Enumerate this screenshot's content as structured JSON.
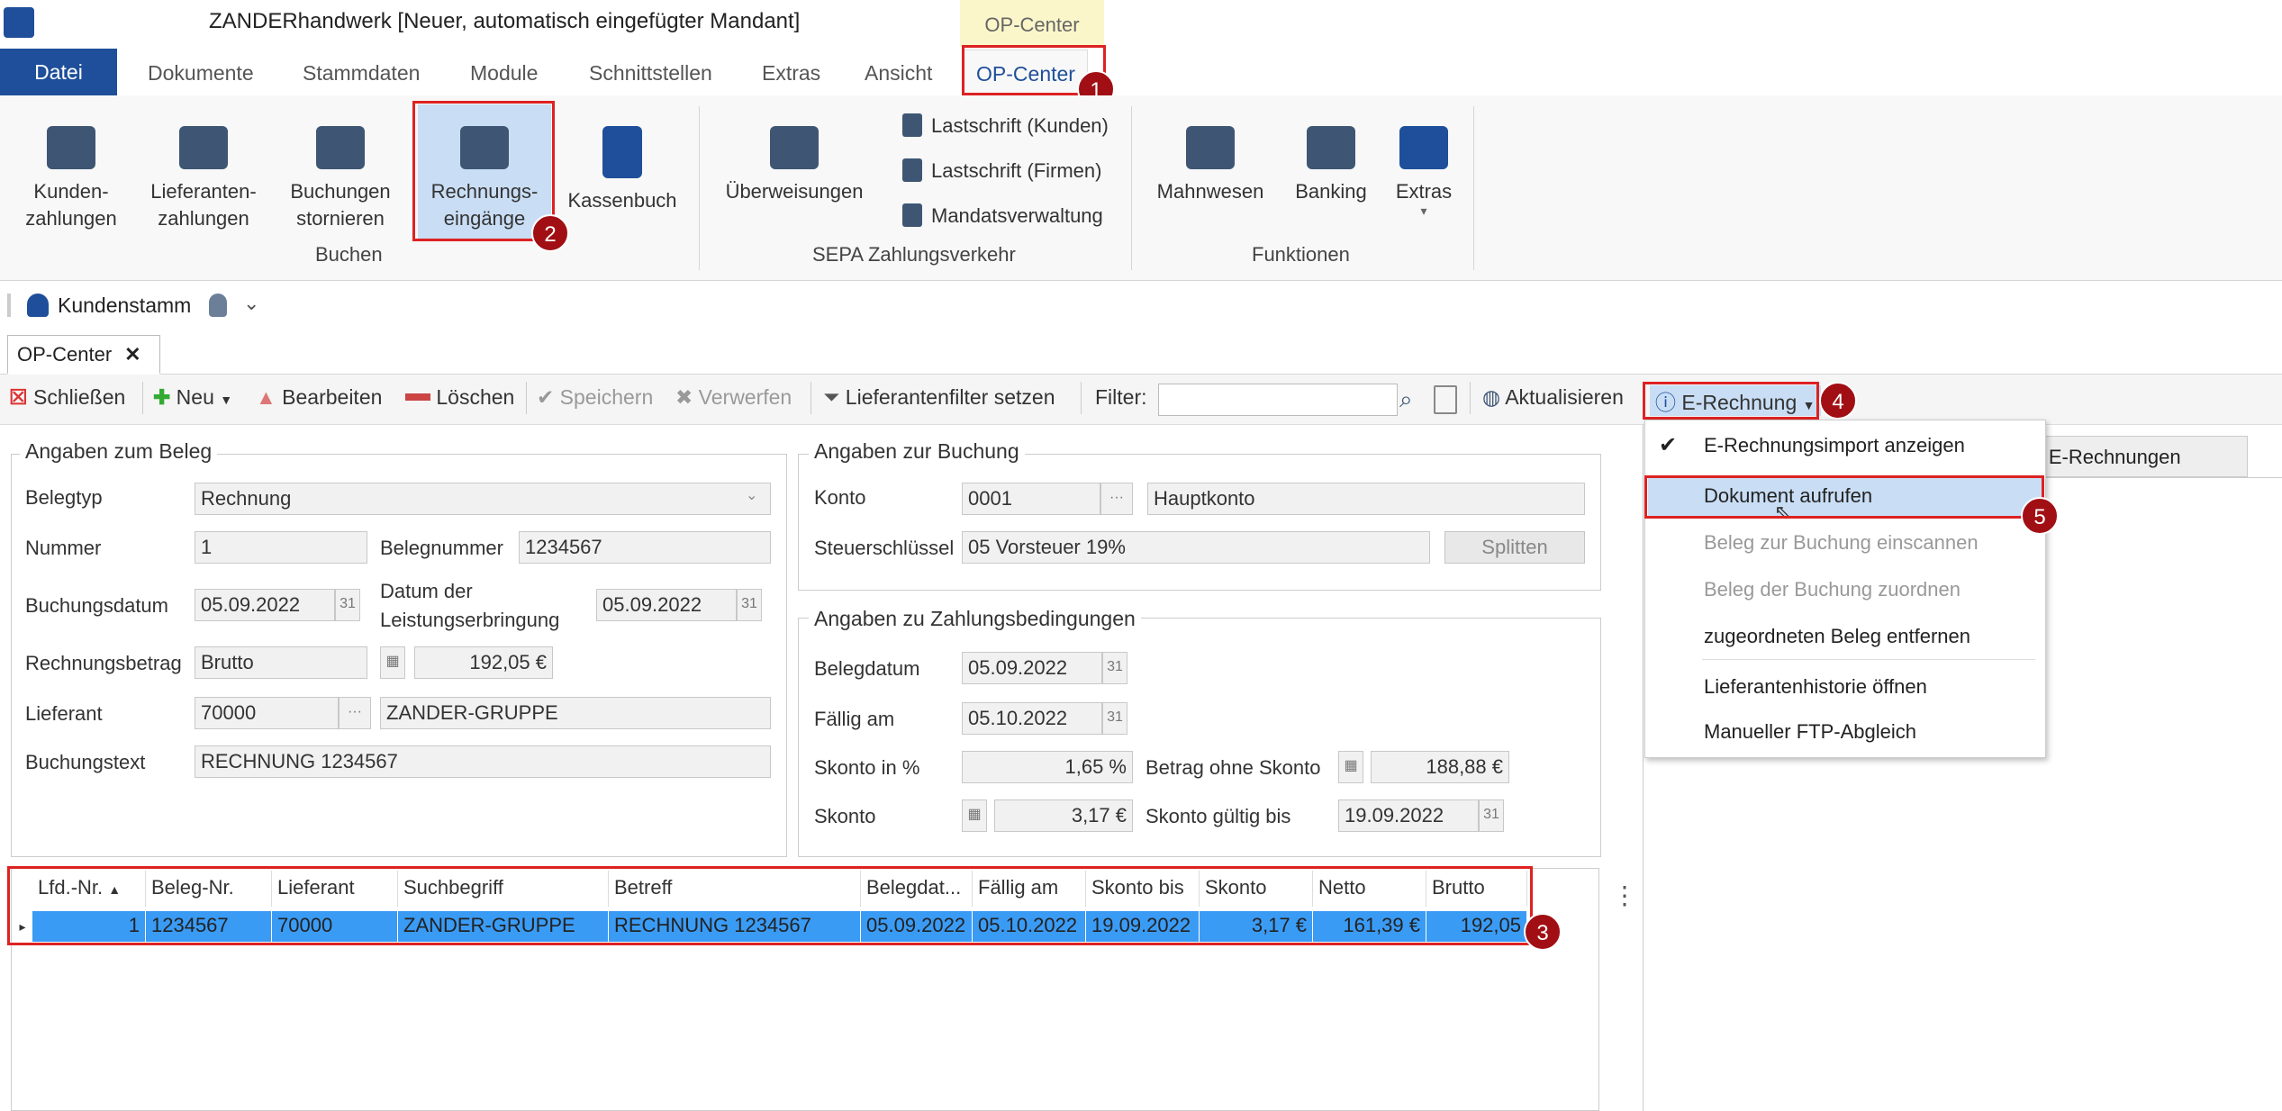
{
  "window": {
    "title": "ZANDERhandwerk [Neuer, automatisch eingefügter Mandant]",
    "context_header": "OP-Center"
  },
  "tabs": [
    "Datei",
    "Dokumente",
    "Stammdaten",
    "Module",
    "Schnittstellen",
    "Extras",
    "Ansicht",
    "OP-Center"
  ],
  "ribbon": {
    "buchen": {
      "label": "Buchen",
      "buttons": [
        [
          "Kunden-",
          "zahlungen"
        ],
        [
          "Lieferanten-",
          "zahlungen"
        ],
        [
          "Buchungen",
          "stornieren"
        ],
        [
          "Rechnungs-",
          "eingänge"
        ],
        [
          "Kassenbuch",
          ""
        ]
      ]
    },
    "sepa": {
      "label": "SEPA Zahlungsverkehr",
      "ueberweisungen": "Überweisungen",
      "items": [
        "Lastschrift (Kunden)",
        "Lastschrift (Firmen)",
        "Mandatsverwaltung"
      ]
    },
    "funktionen": {
      "label": "Funktionen",
      "buttons": [
        "Mahnwesen",
        "Banking",
        "Extras"
      ]
    }
  },
  "breadcrumb": "Kundenstamm",
  "doctab": "OP-Center",
  "toolbar": {
    "schliessen": "Schließen",
    "neu": "Neu",
    "bearbeiten": "Bearbeiten",
    "loeschen": "Löschen",
    "speichern": "Speichern",
    "verwerfen": "Verwerfen",
    "lieferantenfilter": "Lieferantenfilter setzen",
    "filter_label": "Filter:",
    "filter_value": "",
    "aktualisieren": "Aktualisieren",
    "erechnung": "E-Rechnung"
  },
  "beleg": {
    "legend": "Angaben zum Beleg",
    "belegtyp_l": "Belegtyp",
    "belegtyp": "Rechnung",
    "nummer_l": "Nummer",
    "nummer": "1",
    "belegnummer_l": "Belegnummer",
    "belegnummer": "1234567",
    "buchungsdatum_l": "Buchungsdatum",
    "buchungsdatum": "05.09.2022",
    "leistung_l1": "Datum der",
    "leistung_l2": "Leistungserbringung",
    "leistung": "05.09.2022",
    "betrag_l": "Rechnungsbetrag",
    "betrag_art": "Brutto",
    "betrag": "192,05 €",
    "lieferant_l": "Lieferant",
    "lieferant": "70000",
    "lieferant_name": "ZANDER-GRUPPE",
    "text_l": "Buchungstext",
    "text": "RECHNUNG 1234567"
  },
  "buchung": {
    "legend": "Angaben zur Buchung",
    "konto_l": "Konto",
    "konto": "0001",
    "konto_name": "Hauptkonto",
    "steuer_l": "Steuerschlüssel",
    "steuer": "05 Vorsteuer 19%",
    "splitten": "Splitten"
  },
  "zahlung": {
    "legend": "Angaben zu Zahlungsbedingungen",
    "belegdatum_l": "Belegdatum",
    "belegdatum": "05.09.2022",
    "faellig_l": "Fällig am",
    "faellig": "05.10.2022",
    "skonto_pct_l": "Skonto in %",
    "skonto_pct": "1,65 %",
    "ohne_skonto_l": "Betrag ohne Skonto",
    "ohne_skonto": "188,88 €",
    "skonto_l": "Skonto",
    "skonto": "3,17 €",
    "gueltig_l": "Skonto gültig bis",
    "gueltig": "19.09.2022"
  },
  "table": {
    "headers": [
      "Lfd.-Nr.",
      "Beleg-Nr.",
      "Lieferant",
      "Suchbegriff",
      "Betreff",
      "Belegdat...",
      "Fällig am",
      "Skonto bis",
      "Skonto",
      "Netto",
      "Brutto"
    ],
    "row": [
      "1",
      "1234567",
      "70000",
      "ZANDER-GRUPPE",
      "RECHNUNG 1234567",
      "05.09.2022",
      "05.10.2022",
      "19.09.2022",
      "3,17 €",
      "161,39 €",
      "192,05"
    ]
  },
  "right_tab": "digte E-Rechnungen",
  "menu": {
    "items": [
      "E-Rechnungsimport anzeigen",
      "Dokument aufrufen",
      "Beleg zur Buchung einscannen",
      "Beleg der Buchung zuordnen",
      "zugeordneten Beleg entfernen",
      "Lieferantenhistorie öffnen",
      "Manueller FTP-Abgleich"
    ]
  },
  "badges": [
    "1",
    "2",
    "3",
    "4",
    "5"
  ],
  "colors": {
    "accent": "#1f4f9a",
    "badge": "#a10f14",
    "highlight": "#3a9bf5"
  }
}
